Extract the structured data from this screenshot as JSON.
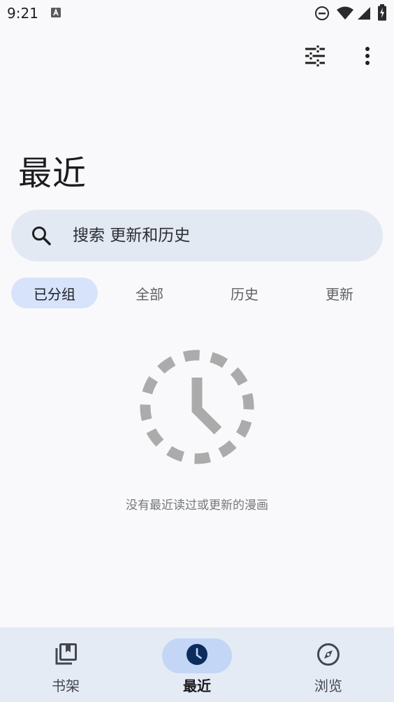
{
  "status_bar": {
    "time": "9:21",
    "icons": [
      "text-a-icon",
      "do-not-disturb-icon",
      "wifi-icon",
      "signal-icon",
      "battery-charging-icon"
    ]
  },
  "toolbar": {
    "filter_icon": "tune-icon",
    "more_icon": "more-vert-icon"
  },
  "page": {
    "title": "最近"
  },
  "search": {
    "placeholder": "搜索 更新和历史",
    "icon": "search-icon"
  },
  "tabs": [
    {
      "label": "已分组",
      "active": true
    },
    {
      "label": "全部",
      "active": false
    },
    {
      "label": "历史",
      "active": false
    },
    {
      "label": "更新",
      "active": false
    }
  ],
  "empty_state": {
    "icon": "history-clock-icon",
    "message": "没有最近读过或更新的漫画"
  },
  "bottom_nav": {
    "items": [
      {
        "label": "书架",
        "icon": "library-books-icon",
        "active": false
      },
      {
        "label": "最近",
        "icon": "clock-icon",
        "active": true
      },
      {
        "label": "浏览",
        "icon": "compass-icon",
        "active": false
      }
    ]
  },
  "colors": {
    "background": "#f9f9fb",
    "search_bg": "#e3e9f3",
    "active_tab_bg": "#d7e3fa",
    "nav_bg": "#e4ebf5",
    "nav_active_pill": "#c3d6f6",
    "accent_dark": "#0d2c5e"
  }
}
